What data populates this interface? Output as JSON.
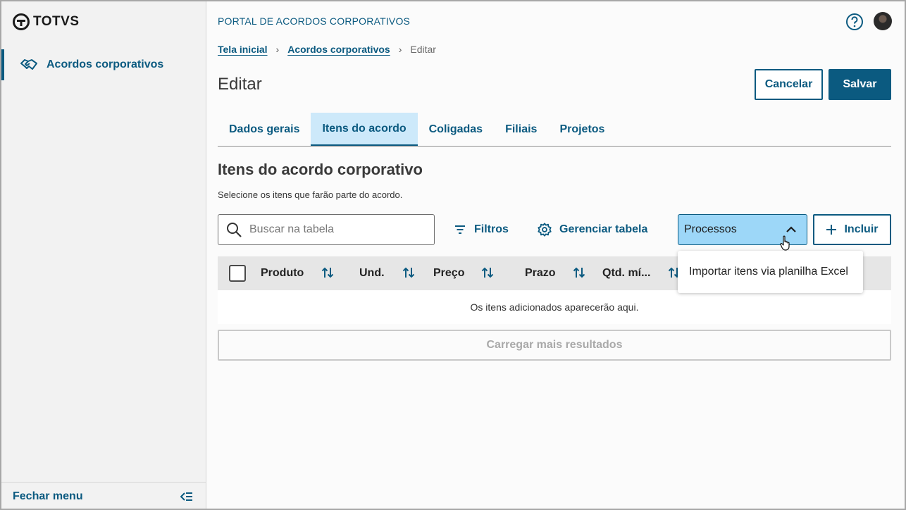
{
  "brand": {
    "logo_text": "TOTVS"
  },
  "sidebar": {
    "items": [
      {
        "label": "Acordos corporativos",
        "icon": "handshake-icon"
      }
    ],
    "footer_label": "Fechar menu"
  },
  "header": {
    "portal_title": "PORTAL DE ACORDOS CORPORATIVOS"
  },
  "breadcrumb": [
    {
      "label": "Tela inicial"
    },
    {
      "label": "Acordos corporativos"
    },
    {
      "label": "Editar"
    }
  ],
  "page": {
    "title": "Editar",
    "cancel_label": "Cancelar",
    "save_label": "Salvar"
  },
  "tabs": [
    {
      "label": "Dados gerais",
      "active": false
    },
    {
      "label": "Itens do acordo",
      "active": true
    },
    {
      "label": "Coligadas",
      "active": false
    },
    {
      "label": "Filiais",
      "active": false
    },
    {
      "label": "Projetos",
      "active": false
    }
  ],
  "section": {
    "title": "Itens do acordo corporativo",
    "subtitle": "Selecione os itens que farão parte do acordo."
  },
  "toolbar": {
    "search_placeholder": "Buscar na tabela",
    "filters_label": "Filtros",
    "manage_label": "Gerenciar tabela",
    "processes_label": "Processos",
    "include_label": "Incluir"
  },
  "table": {
    "columns": [
      "Produto",
      "Und.",
      "Preço",
      "Prazo",
      "Qtd. mí..."
    ],
    "empty_message": "Os itens adicionados aparecerão aqui.",
    "load_more_label": "Carregar mais resultados"
  },
  "processes_menu": {
    "items": [
      "Importar itens via planilha Excel"
    ]
  },
  "colors": {
    "accent": "#0b5a80",
    "tab_active_bg": "#cde9fa",
    "select_bg": "#9dd7f8"
  }
}
